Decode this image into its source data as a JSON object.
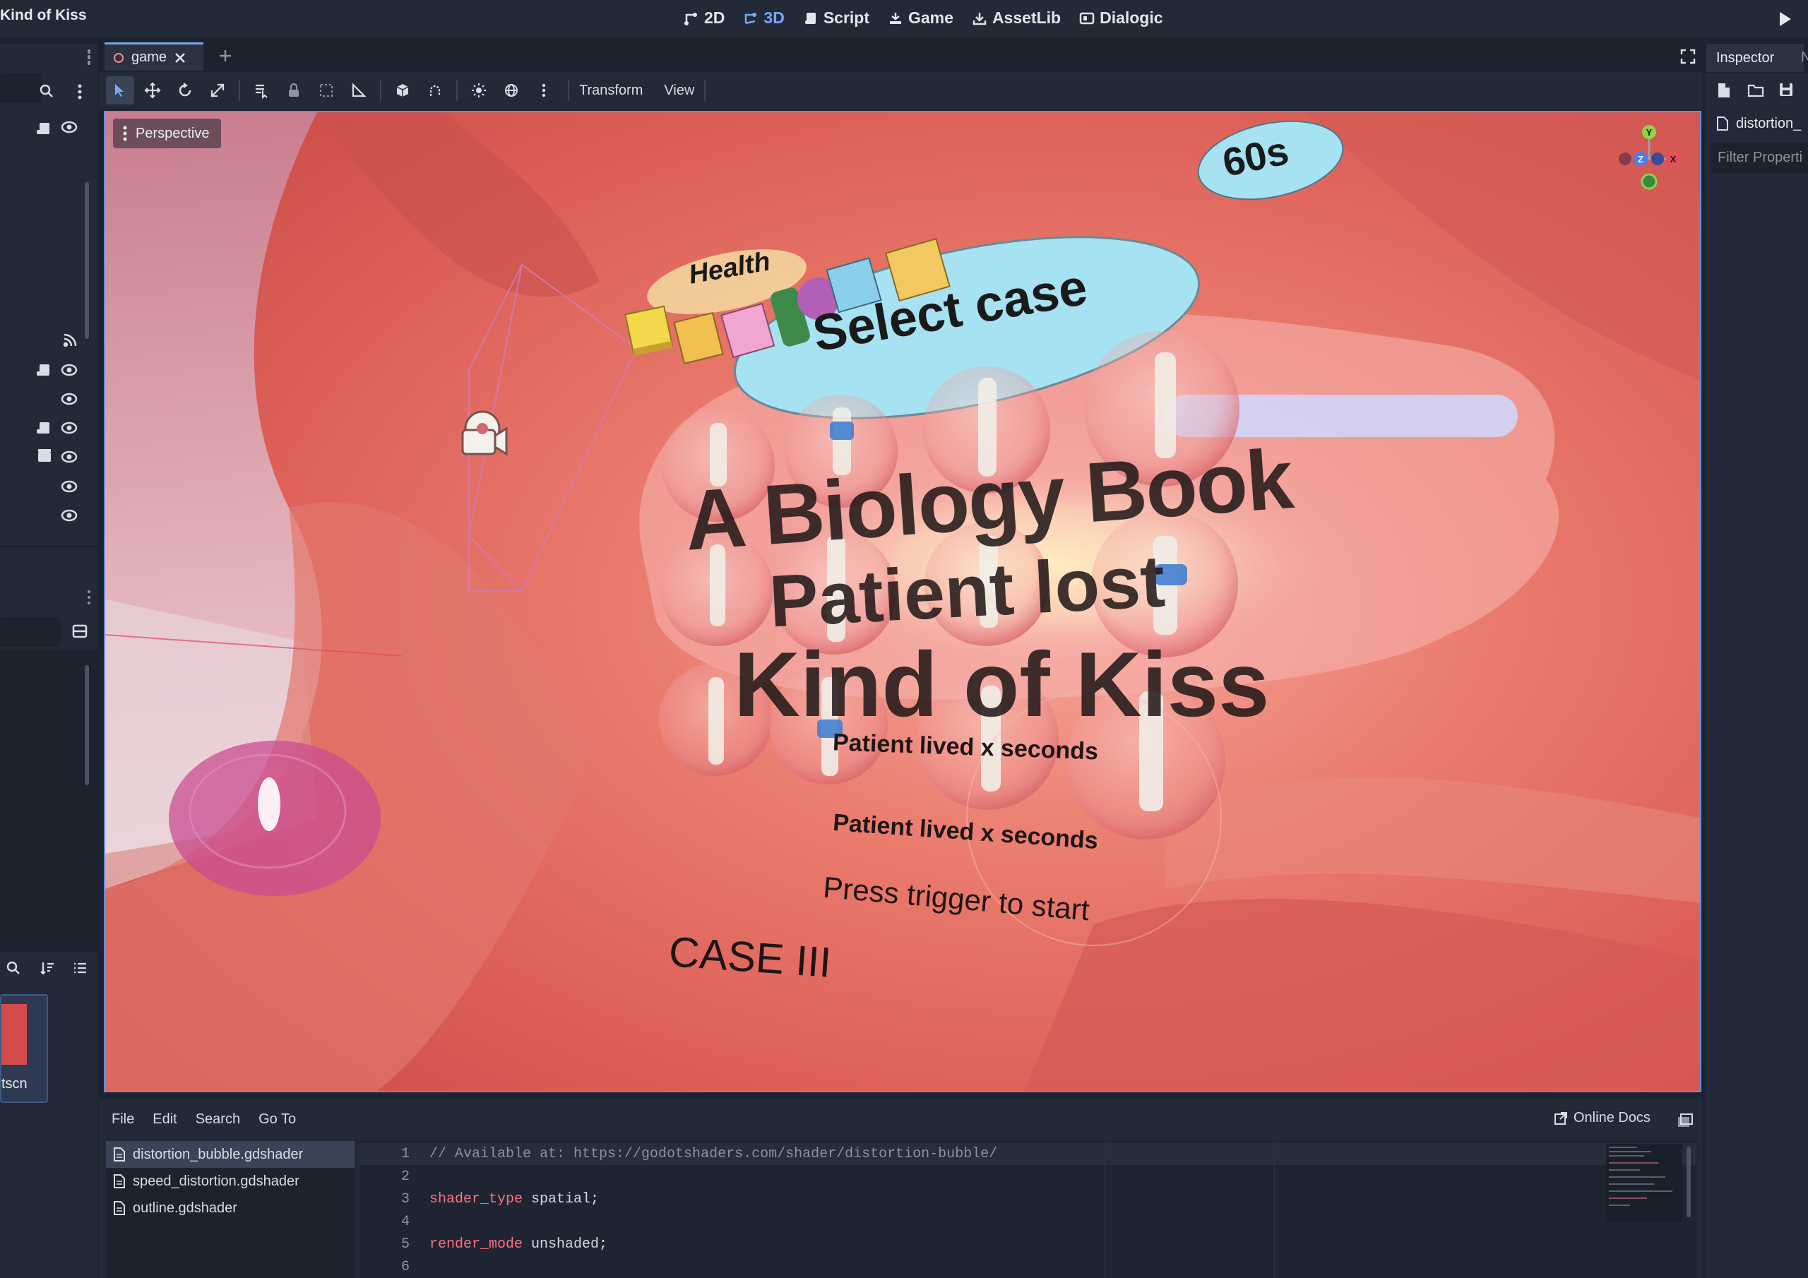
{
  "app": {
    "title": "Kind of Kiss"
  },
  "main_tabs": [
    {
      "label": "2D",
      "icon": "2d-icon"
    },
    {
      "label": "3D",
      "icon": "3d-icon",
      "active": true
    },
    {
      "label": "Script",
      "icon": "script-icon"
    },
    {
      "label": "Game",
      "icon": "game-icon"
    },
    {
      "label": "AssetLib",
      "icon": "assetlib-icon"
    },
    {
      "label": "Dialogic",
      "icon": "dialogic-icon"
    }
  ],
  "scene_tab": {
    "label": "game"
  },
  "toolbar": {
    "transform_label": "Transform",
    "view_label": "View"
  },
  "viewport": {
    "perspective_label": "Perspective",
    "timer_label": "60s",
    "health_label": "Health",
    "select_label": "Select case",
    "title_lines": [
      "A Biology Book",
      "Patient lost",
      "Kind of Kiss"
    ],
    "lived_label_1": "Patient lived x seconds",
    "lived_label_2": "Patient lived x seconds",
    "press_label": "Press trigger to start",
    "case_label": "CASE III",
    "gizmo_axes": {
      "y": "Y",
      "x": "X",
      "z": "Z"
    }
  },
  "inspector": {
    "tab_label": "Inspector",
    "tab2_label": "N",
    "resource_label": "distortion_",
    "filter_placeholder": "Filter Properti"
  },
  "filesystem": {
    "thumb_label": "tscn"
  },
  "script_panel": {
    "menus": [
      "File",
      "Edit",
      "Search",
      "Go To"
    ],
    "online_docs": "Online Docs",
    "files": [
      {
        "name": "distortion_bubble.gdshader",
        "active": true
      },
      {
        "name": "speed_distortion.gdshader"
      },
      {
        "name": "outline.gdshader"
      }
    ],
    "code_lines": [
      {
        "n": "1",
        "text": "// Available at: https://godotshaders.com/shader/distortion-bubble/"
      },
      {
        "n": "2",
        "text": ""
      },
      {
        "n": "3",
        "kw": "shader_type",
        "rest": " spatial;"
      },
      {
        "n": "4",
        "text": ""
      },
      {
        "n": "5",
        "kw": "render_mode",
        "rest": " unshaded;"
      },
      {
        "n": "6",
        "text": ""
      }
    ]
  },
  "colors": {
    "accent": "#79a6f2",
    "bg": "#1c222e",
    "panel": "#232a37",
    "flesh": "#e26b62",
    "bubble_blue": "#a6e2f2"
  }
}
